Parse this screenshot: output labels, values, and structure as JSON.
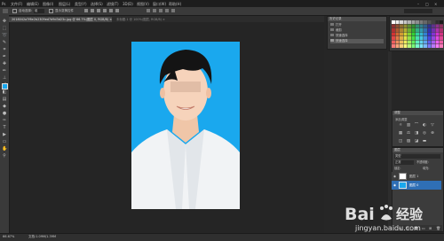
{
  "menubar": {
    "items": [
      "文件(F)",
      "编辑(E)",
      "图像(I)",
      "图层(L)",
      "类型(Y)",
      "选择(S)",
      "滤镜(T)",
      "3D(D)",
      "视图(V)",
      "窗口(W)",
      "帮助(H)"
    ]
  },
  "options_bar": {
    "label": "■",
    "items": [
      "自动选择:",
      "组",
      "显示变换控件"
    ]
  },
  "tabs": [
    {
      "label": "2018042a7f6e2b2309ed7d9d3d23c.jpg @ 66.7%(图层 0, RGB/8) ×"
    },
    {
      "label": "未标题-1 @ 100%(图层, RGB/8) ×"
    }
  ],
  "history_panel": {
    "header": "历史记录",
    "rows": [
      "打开",
      "裁剪",
      "快速选择",
      "快速选择"
    ]
  },
  "adjustments_panel": {
    "header": "调整",
    "subtitle": "添加调整"
  },
  "layers_panel": {
    "header": "图层",
    "kind_label": "类型",
    "blend_mode": "正常",
    "opacity_label": "不透明度:",
    "lock_label": "锁定:",
    "fill_label": "填充:",
    "layers": [
      {
        "name": "图层 1"
      },
      {
        "name": "图层 0"
      }
    ]
  },
  "status_bar": {
    "zoom": "66.67%",
    "doc": "文档:1.09M/1.39M"
  },
  "watermark": {
    "logo_text": "Bai",
    "logo_text_2": "经验",
    "url": "jingyan.baidu.com"
  },
  "colors": {
    "photo_background": "#1aa8ee",
    "foreground_color": "#1aa8ee",
    "selected_layer": "#2f6fb5"
  }
}
